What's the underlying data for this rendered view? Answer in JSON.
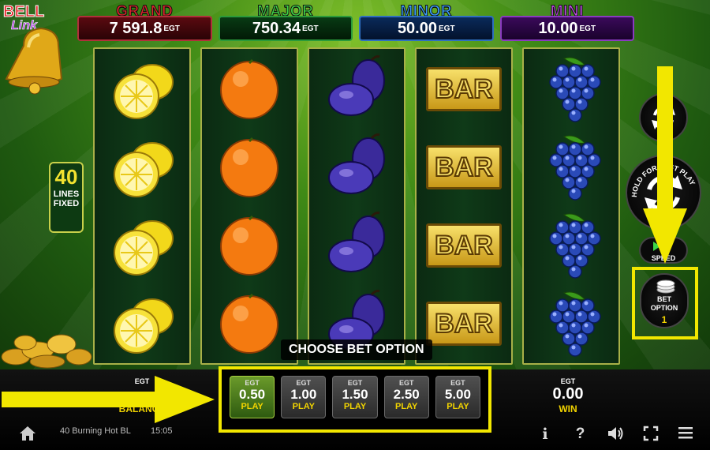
{
  "game": {
    "logo_line1": "BELL",
    "logo_line2": "Link",
    "lines_number": "40",
    "lines_label1": "LINES",
    "lines_label2": "FIXED",
    "choose_bet": "CHOOSE BET OPTION",
    "title": "40 Burning Hot BL",
    "time": "15:05"
  },
  "jackpots": [
    {
      "name": "GRAND",
      "value": "7 591.8",
      "suffix": "EGT",
      "color": "#e0242b"
    },
    {
      "name": "MAJOR",
      "value": "750.34",
      "suffix": "EGT",
      "color": "#3dd646"
    },
    {
      "name": "MINOR",
      "value": "50.00",
      "suffix": "EGT",
      "color": "#3aa0ff"
    },
    {
      "name": "MINI",
      "value": "10.00",
      "suffix": "EGT",
      "color": "#c04ae6"
    }
  ],
  "reels": [
    {
      "symbol": "lemon-icon"
    },
    {
      "symbol": "orange-icon"
    },
    {
      "symbol": "plum-icon"
    },
    {
      "symbol": "bar-icon",
      "bar_text": "BAR"
    },
    {
      "symbol": "grapes-icon"
    }
  ],
  "controls": {
    "hold_text": "HOLD FOR FAST PLAY",
    "speed_label": "SPEED",
    "bet_option_label1": "BET",
    "bet_option_label2": "OPTION",
    "bet_option_value": "1"
  },
  "bets": [
    {
      "currency": "EGT",
      "value": "0.50",
      "label": "PLAY",
      "selected": true
    },
    {
      "currency": "EGT",
      "value": "1.00",
      "label": "PLAY",
      "selected": false
    },
    {
      "currency": "EGT",
      "value": "1.50",
      "label": "PLAY",
      "selected": false
    },
    {
      "currency": "EGT",
      "value": "2.50",
      "label": "PLAY",
      "selected": false
    },
    {
      "currency": "EGT",
      "value": "5.00",
      "label": "PLAY",
      "selected": false
    }
  ],
  "balance": {
    "currency": "EGT",
    "label": "BALANCE"
  },
  "win": {
    "currency": "EGT",
    "value": "0.00",
    "label": "WIN"
  },
  "bottom_icons": [
    "home-icon",
    "info-icon",
    "help-icon",
    "sound-icon",
    "fullscreen-icon",
    "menu-icon"
  ],
  "colors": {
    "highlight": "#f2e700",
    "play_label": "#f2d400",
    "reel_border": "#a8b048"
  }
}
